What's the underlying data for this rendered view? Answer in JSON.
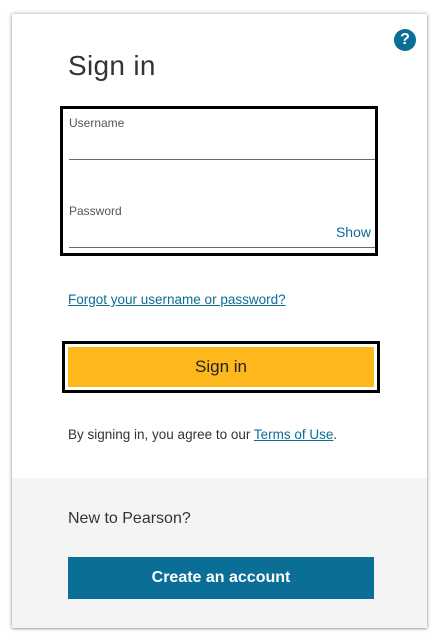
{
  "help": {
    "icon": "help-icon",
    "glyph": "?"
  },
  "title": "Sign in",
  "username": {
    "label": "Username",
    "value": ""
  },
  "password": {
    "label": "Password",
    "value": "",
    "show_label": "Show"
  },
  "forgot_link": "Forgot your username or password?",
  "sign_in_button": "Sign in",
  "agreement": {
    "prefix": "By signing in, you agree to our ",
    "link": "Terms of Use",
    "suffix": "."
  },
  "register": {
    "prompt": "New to Pearson?",
    "button": "Create an account"
  },
  "colors": {
    "brand_blue": "#0a6e96",
    "sign_in_yellow": "#ffb81c",
    "footer_bg": "#f4f4f4"
  }
}
